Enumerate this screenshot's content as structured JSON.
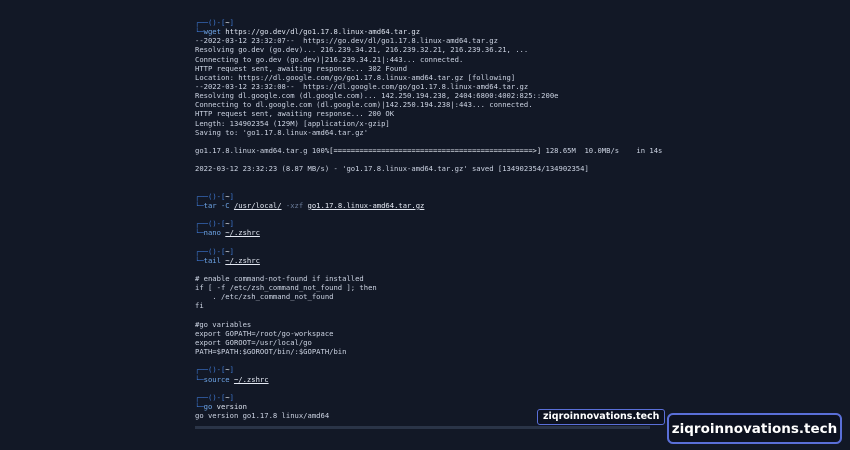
{
  "prompt": {
    "top": "┌──(",
    "user": "",
    "host_sep": ")-[",
    "dir": "~",
    "dir_end": "]",
    "bottom": "└─"
  },
  "blocks": [
    {
      "type": "command",
      "cmd": "wget",
      "args": "https://go.dev/dl/go1.17.8.linux-amd64.tar.gz"
    },
    {
      "type": "output",
      "lines": [
        "--2022-03-12 23:32:07--  https://go.dev/dl/go1.17.8.linux-amd64.tar.gz",
        "Resolving go.dev (go.dev)... 216.239.34.21, 216.239.32.21, 216.239.36.21, ...",
        "Connecting to go.dev (go.dev)|216.239.34.21|:443... connected.",
        "HTTP request sent, awaiting response... 302 Found",
        "Location: https://dl.google.com/go/go1.17.8.linux-amd64.tar.gz [following]",
        "--2022-03-12 23:32:08--  https://dl.google.com/go/go1.17.8.linux-amd64.tar.gz",
        "Resolving dl.google.com (dl.google.com)... 142.250.194.238, 2404:6800:4002:825::200e",
        "Connecting to dl.google.com (dl.google.com)|142.250.194.238|:443... connected.",
        "HTTP request sent, awaiting response... 200 OK",
        "Length: 134902354 (129M) [application/x-gzip]",
        "Saving to: 'go1.17.8.linux-amd64.tar.gz'"
      ]
    },
    {
      "type": "progress",
      "file": "go1.17.8.linux-amd64.tar.g",
      "percent": "100%",
      "bar": "[==============================================>]",
      "stats": "128.65M  10.0MB/s    in 14s"
    },
    {
      "type": "output",
      "lines": [
        "2022-03-12 23:32:23 (8.87 MB/s) - 'go1.17.8.linux-amd64.tar.gz' saved [134902354/134902354]"
      ]
    },
    {
      "type": "command",
      "cmd": "tar -C",
      "path1": "/usr/local/",
      "flag": "-xzf",
      "path2": "go1.17.8.linux-amd64.tar.gz"
    },
    {
      "type": "command",
      "cmd": "nano",
      "path1": "~/.zshrc"
    },
    {
      "type": "command",
      "cmd": "tail",
      "path1": "~/.zshrc"
    },
    {
      "type": "output",
      "lines": [
        "# enable command-not-found if installed",
        "if [ -f /etc/zsh_command_not_found ]; then",
        "    . /etc/zsh_command_not_found",
        "fi",
        "",
        "#go variables",
        "export GOPATH=/root/go-workspace",
        "export GOROOT=/usr/local/go",
        "PATH=$PATH:$GOROOT/bin/:$GOPATH/bin"
      ]
    },
    {
      "type": "command",
      "cmd": "source",
      "path1": "~/.zshrc"
    },
    {
      "type": "command",
      "cmd": "go",
      "args": "version"
    },
    {
      "type": "output",
      "lines": [
        "go version go1.17.8 linux/amd64"
      ]
    }
  ],
  "watermark_small": "ziqroinnovations.tech",
  "watermark_big": "ziqroinnovations.tech",
  "colors": {
    "background": "#121826",
    "prompt": "#3f7ad6",
    "command": "#6fa6e8",
    "watermark_border": "#5a6fd8"
  }
}
